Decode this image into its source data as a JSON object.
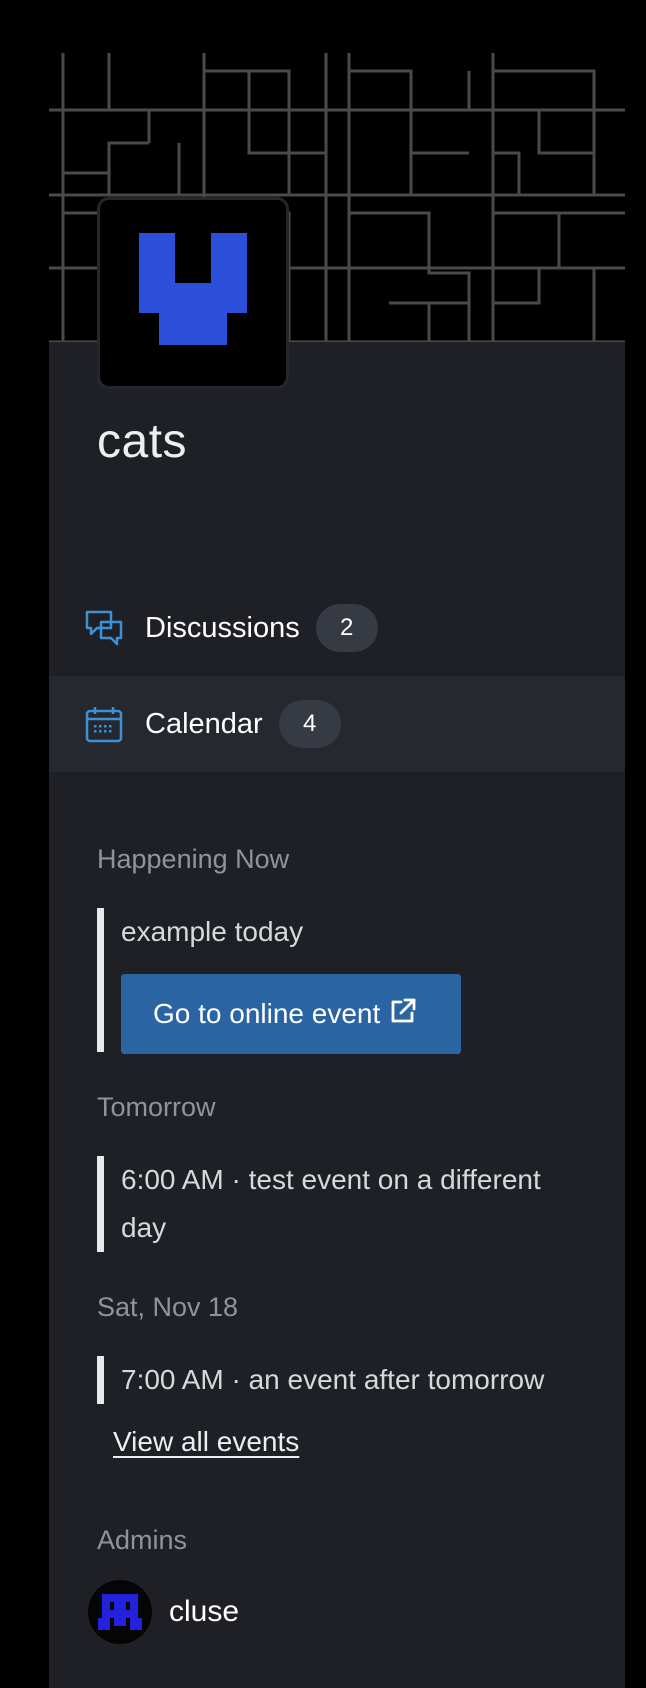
{
  "group": {
    "name": "cats",
    "banner_color": "#4a4a4a",
    "logo_color": "#2b4fd8"
  },
  "nav": {
    "discussions": {
      "label": "Discussions",
      "count": "2",
      "icon": "chat-bubbles-icon"
    },
    "calendar": {
      "label": "Calendar",
      "count": "4",
      "icon": "calendar-icon"
    }
  },
  "events": {
    "happening_now": {
      "heading": "Happening Now",
      "title": "example today",
      "button_label": "Go to online event",
      "button_icon": "external-link-icon"
    },
    "tomorrow": {
      "heading": "Tomorrow",
      "title": "6:00 AM · test event on a different day"
    },
    "sat_nov_18": {
      "heading": "Sat, Nov 18",
      "title": "7:00 AM · an event after tomorrow"
    },
    "view_all_label": "View all events"
  },
  "admins": {
    "heading": "Admins",
    "items": [
      {
        "name": "cluse",
        "avatar_color": "#2222dd"
      }
    ]
  },
  "colors": {
    "accent": "#2b64a3",
    "panel_bg": "#1e2025",
    "icon_blue": "#3d8fd6"
  }
}
